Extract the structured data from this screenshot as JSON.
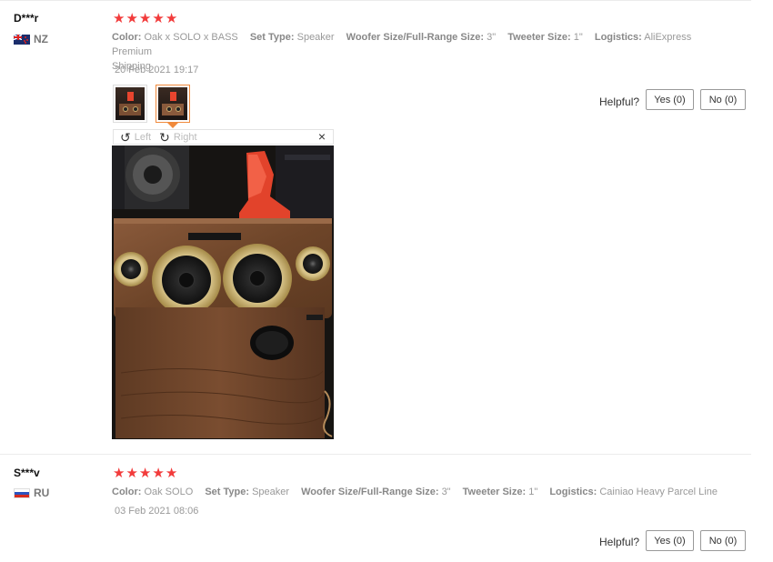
{
  "reviews": [
    {
      "user": "D***r",
      "country": "NZ",
      "rating_stars": 5,
      "attrs": [
        {
          "label": "Color:",
          "value": "Oak x SOLO x BASS"
        },
        {
          "label": "Set Type:",
          "value": "Speaker"
        },
        {
          "label": "Woofer Size/Full-Range Size:",
          "value": "3\""
        },
        {
          "label": "Tweeter Size:",
          "value": "1\""
        },
        {
          "label": "Logistics:",
          "value": "AliExpress Premium"
        }
      ],
      "attrs_overflow": "Shipping",
      "date": "20 Feb 2021 19:17",
      "photo_viewer": {
        "rotate_left_label": "Left",
        "rotate_right_label": "Right",
        "close_glyph": "×"
      },
      "helpful_label": "Helpful?",
      "yes_label": "Yes (0)",
      "no_label": "No (0)"
    },
    {
      "user": "S***v",
      "country": "RU",
      "rating_stars": 5,
      "attrs": [
        {
          "label": "Color:",
          "value": "Oak SOLO"
        },
        {
          "label": "Set Type:",
          "value": "Speaker"
        },
        {
          "label": "Woofer Size/Full-Range Size:",
          "value": "3\""
        },
        {
          "label": "Tweeter Size:",
          "value": "1\""
        },
        {
          "label": "Logistics:",
          "value": "Cainiao Heavy Parcel Line"
        }
      ],
      "date": "03 Feb 2021 08:06",
      "helpful_label": "Helpful?",
      "yes_label": "Yes (0)",
      "no_label": "No (0)"
    }
  ],
  "colors": {
    "star": "#f23b3b",
    "thumb_active_border": "#f08a3c",
    "muted_text": "#999999"
  },
  "icons": {
    "star": "★",
    "rotate_left": "↺",
    "rotate_right": "↻"
  }
}
